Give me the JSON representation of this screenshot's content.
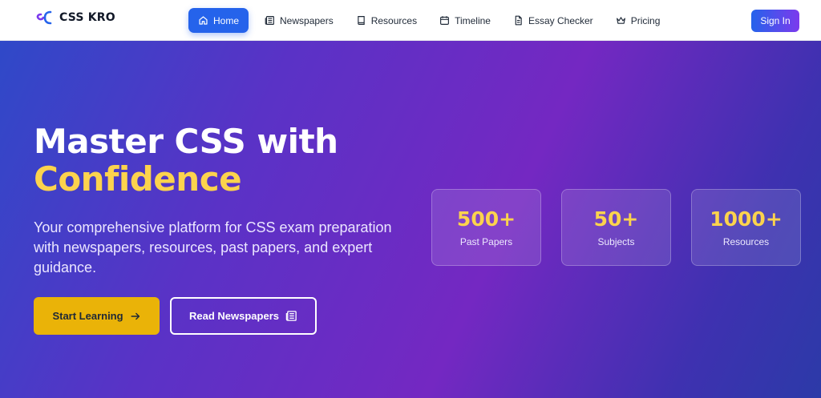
{
  "brand": {
    "name": "CSS KRO"
  },
  "nav": {
    "items": [
      {
        "label": "Home",
        "icon": "home-icon"
      },
      {
        "label": "Newspapers",
        "icon": "newspaper-icon"
      },
      {
        "label": "Resources",
        "icon": "book-icon"
      },
      {
        "label": "Timeline",
        "icon": "calendar-icon"
      },
      {
        "label": "Essay Checker",
        "icon": "document-icon"
      },
      {
        "label": "Pricing",
        "icon": "crown-icon"
      }
    ],
    "active": "Home",
    "signin_label": "Sign In"
  },
  "hero": {
    "title_line1": "Master CSS with",
    "title_line2": "Confidence",
    "subtitle": "Your comprehensive platform for CSS exam preparation with newspapers, resources, past papers, and expert guidance.",
    "primary_button": "Start Learning",
    "secondary_button": "Read Newspapers"
  },
  "stats": [
    {
      "value": "500+",
      "label": "Past Papers"
    },
    {
      "value": "50+",
      "label": "Subjects"
    },
    {
      "value": "1000+",
      "label": "Resources"
    }
  ],
  "colors": {
    "accent_blue": "#2563eb",
    "accent_purple": "#7c3aed",
    "highlight_yellow": "#fcd34d",
    "button_yellow": "#eab308"
  }
}
